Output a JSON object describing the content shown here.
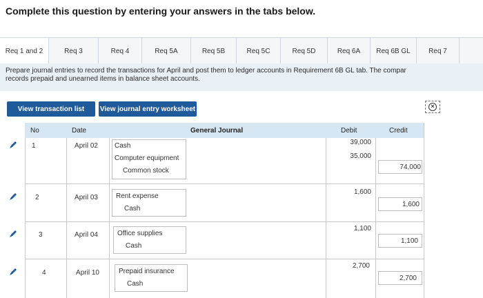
{
  "heading": "Complete this question by entering your answers in the tabs below.",
  "tabs": [
    {
      "label": "Req 1 and 2",
      "active": true
    },
    {
      "label": "Req 3",
      "active": false
    },
    {
      "label": "Req 4",
      "active": false
    },
    {
      "label": "Req 5A",
      "active": false
    },
    {
      "label": "Req 5B",
      "active": false
    },
    {
      "label": "Req 5C",
      "active": false
    },
    {
      "label": "Req 5D",
      "active": false
    },
    {
      "label": "Req 6A",
      "active": false
    },
    {
      "label": "Req 6B GL",
      "active": false
    },
    {
      "label": "Req 7",
      "active": false
    }
  ],
  "instructions": {
    "line1": "Prepare journal entries to record the transactions for April and post them to ledger accounts in Requirement 6B GL tab. The compar",
    "line2": "records prepaid and unearned items in balance sheet accounts."
  },
  "buttons": {
    "view_transactions": "View transaction list",
    "view_worksheet": "View journal entry worksheet"
  },
  "table": {
    "headers": {
      "no": "No",
      "date": "Date",
      "journal": "General Journal",
      "debit": "Debit",
      "credit": "Credit"
    },
    "entries": [
      {
        "no": "1",
        "date": "April 02",
        "lines": [
          {
            "account": "Cash",
            "debit": "39,000",
            "credit": ""
          },
          {
            "account": "Computer equipment",
            "debit": "35,000",
            "credit": ""
          },
          {
            "account": "Common stock",
            "debit": "",
            "credit": "74,000"
          }
        ]
      },
      {
        "no": "2",
        "date": "April 03",
        "lines": [
          {
            "account": "Rent expense",
            "debit": "1,600",
            "credit": ""
          },
          {
            "account": "Cash",
            "debit": "",
            "credit": "1,600"
          }
        ]
      },
      {
        "no": "3",
        "date": "April 04",
        "lines": [
          {
            "account": "Office supplies",
            "debit": "1,100",
            "credit": ""
          },
          {
            "account": "Cash",
            "debit": "",
            "credit": "1,100"
          }
        ]
      },
      {
        "no": "4",
        "date": "April 10",
        "lines": [
          {
            "account": "Prepaid insurance",
            "debit": "2,700",
            "credit": ""
          },
          {
            "account": "Cash",
            "debit": "",
            "credit": "2,700"
          }
        ]
      }
    ]
  },
  "colors": {
    "accent": "#1f5a9a",
    "header_bg": "#d7e6f3",
    "panel_bg": "#e9f0f6"
  }
}
